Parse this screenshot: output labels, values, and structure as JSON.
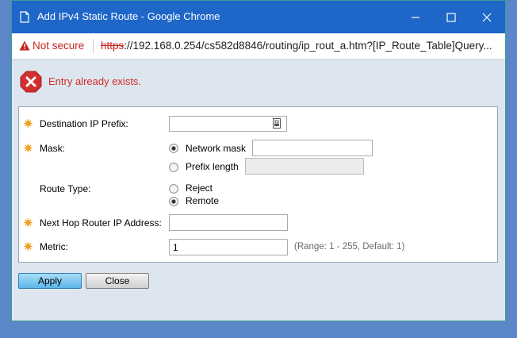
{
  "window": {
    "title": "Add IPv4 Static Route - Google Chrome",
    "controls": [
      "minimize-icon",
      "maximize-icon",
      "close-icon"
    ]
  },
  "address_bar": {
    "security_text": "Not secure",
    "url_scheme": "https",
    "url_rest": "://192.168.0.254/cs582d8846/routing/ip_rout_a.htm?[IP_Route_Table]Query..."
  },
  "error": {
    "icon": "error-x-icon",
    "message": "Entry already exists."
  },
  "form": {
    "destination_ip_prefix": {
      "label": "Destination IP Prefix:",
      "required": true,
      "value": ""
    },
    "mask": {
      "label": "Mask:",
      "required": true,
      "options": [
        {
          "label": "Network mask",
          "selected": true,
          "value": "",
          "enabled": true
        },
        {
          "label": "Prefix length",
          "selected": false,
          "value": "",
          "enabled": false
        }
      ]
    },
    "route_type": {
      "label": "Route Type:",
      "required": false,
      "options": [
        {
          "label": "Reject",
          "selected": false
        },
        {
          "label": "Remote",
          "selected": true
        }
      ]
    },
    "next_hop": {
      "label": "Next Hop Router IP Address:",
      "required": true,
      "value": ""
    },
    "metric": {
      "label": "Metric:",
      "required": true,
      "value": "1",
      "hint": "(Range: 1 - 255, Default: 1)"
    }
  },
  "buttons": {
    "apply": "Apply",
    "close": "Close"
  },
  "colors": {
    "titlebar": "#1e66c8",
    "required_star": "#f0a020",
    "error_text": "#d42a2a",
    "apply_button": "#5cb7ea"
  }
}
